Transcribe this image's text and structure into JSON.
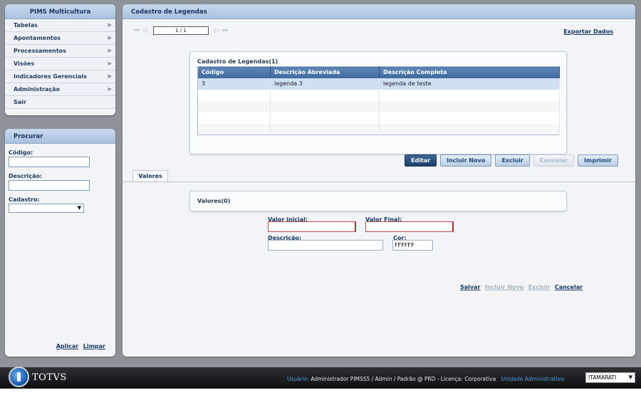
{
  "menu": {
    "title": "PIMS Multicultura",
    "items": [
      {
        "label": "Tabelas",
        "arrow": "▶"
      },
      {
        "label": "Apontamentos",
        "arrow": "▶"
      },
      {
        "label": "Processamentos",
        "arrow": "▶"
      },
      {
        "label": "Visões",
        "arrow": "▶"
      },
      {
        "label": "Indicadores Gerenciais",
        "arrow": "▶"
      },
      {
        "label": "Administração",
        "arrow": "▶"
      },
      {
        "label": "Sair",
        "arrow": ""
      }
    ]
  },
  "search": {
    "title": "Procurar",
    "codigo_label": "Código:",
    "descricao_label": "Descrição:",
    "cadastro_label": "Cadastro:",
    "apply": "Aplicar",
    "clear": "Limpar"
  },
  "main": {
    "title": "Cadastro de Legendas",
    "pager": {
      "first": "⏮",
      "prev": "◁",
      "value": "1 / 1",
      "next": "▷",
      "last": "⏭"
    },
    "export": "Exportar Dados",
    "grid": {
      "title": "Cadastro de Legendas(1)",
      "columns": [
        "Código",
        "Descrição Abreviada",
        "Descrição Completa"
      ],
      "rows": [
        [
          "3",
          "legenda 3",
          "legenda de teste"
        ]
      ]
    },
    "buttons": {
      "edit": "Editar",
      "new": "Incluir Novo",
      "delete": "Excluir",
      "cancel": "Cancelar",
      "print": "Imprimir"
    },
    "tab": "Valores",
    "valores_title": "Valores(0)",
    "form": {
      "valor_inicial_label": "Valor inicial:",
      "valor_final_label": "Valor Final:",
      "descricao_label": "Descrição:",
      "cor_label": "Cor:",
      "cor_value": "FFFFFF"
    },
    "footer": {
      "save": "Salvar",
      "new": "Incluir Novo",
      "delete": "Excluir",
      "cancel": "Cancelar"
    }
  },
  "status": {
    "user_label": "Usuário:",
    "user_text": "Administrador PIMSS5 / Admin / Padrão @ PRD - Licença: Corporativa",
    "unit_label": "Unidade Administrativa:",
    "unit_value": "ITAMARATI",
    "logo": "TOTVS"
  },
  "colors": {
    "header_blue": "#17365d",
    "accent_blue": "#4e9fe5",
    "required_red": "#b72a2a"
  }
}
